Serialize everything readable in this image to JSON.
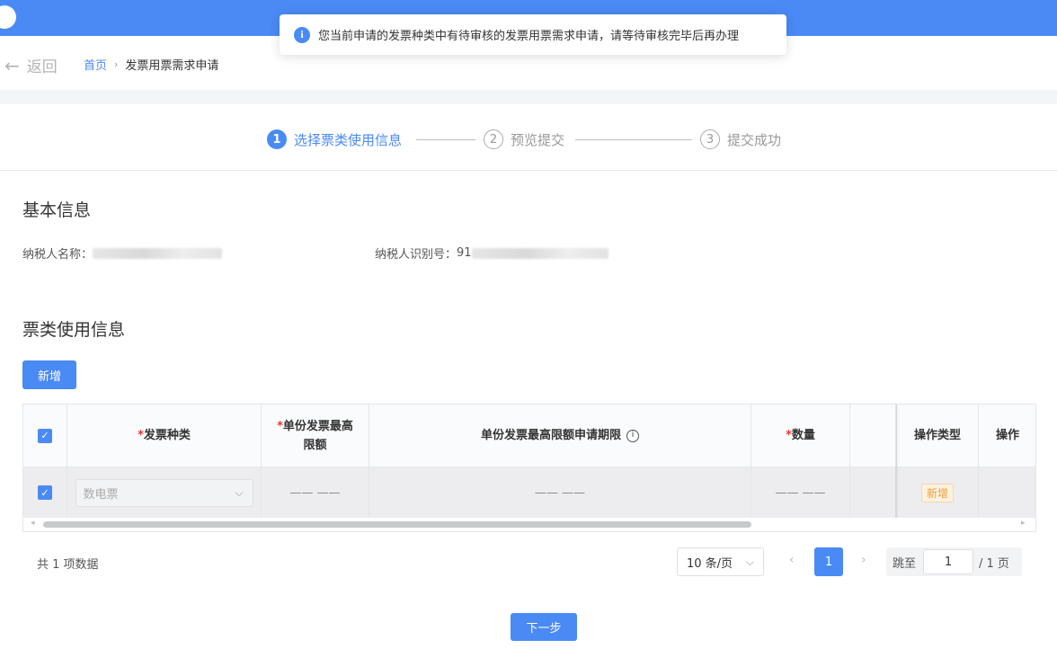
{
  "toast": {
    "message": "您当前申请的发票种类中有待审核的发票用票需求申请，请等待审核完毕后再办理",
    "icon": "info-icon"
  },
  "nav": {
    "back_label": "返回",
    "back_icon": "arrow-left-icon",
    "breadcrumb": {
      "home": "首页",
      "current": "发票用票需求申请"
    }
  },
  "steps": [
    {
      "num": "1",
      "label": "选择票类使用信息",
      "state": "active"
    },
    {
      "num": "2",
      "label": "预览提交",
      "state": "pending"
    },
    {
      "num": "3",
      "label": "提交成功",
      "state": "pending"
    }
  ],
  "basic": {
    "title": "基本信息",
    "taxpayer_name_label": "纳税人名称：",
    "taxpayer_id_label": "纳税人识别号：",
    "taxpayer_id_prefix": "91"
  },
  "ticket": {
    "title": "票类使用信息",
    "add_button": "新增",
    "table": {
      "headers": {
        "type": "发票种类",
        "max_amount_line1": "单份发票最高",
        "max_amount_line2": "限额",
        "period": "单份发票最高限额申请期限",
        "quantity": "数量",
        "op_type": "操作类型",
        "op": "操作"
      },
      "row": {
        "type_placeholder": "数电票",
        "max_amount": "—— ——",
        "period": "—— ——",
        "quantity": "—— ——",
        "op_type": "新增"
      }
    }
  },
  "pagination": {
    "total": "共 1 项数据",
    "page_size": "10 条/页",
    "current": "1",
    "jump_label": "跳至",
    "jump_value": "1",
    "pages": "/ 1 页"
  },
  "next_button": "下一步",
  "colors": {
    "primary": "#4a8af4",
    "required": "#ee3333",
    "tag": "#e9a23b"
  }
}
